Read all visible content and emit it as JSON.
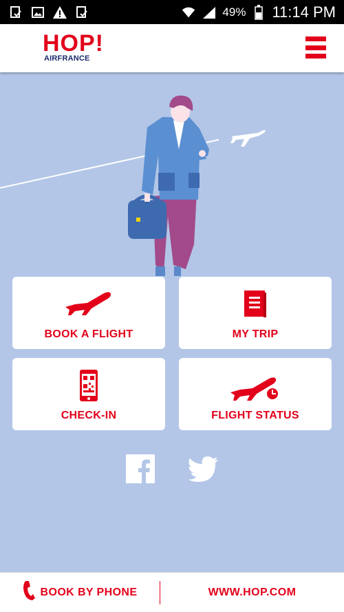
{
  "status_bar": {
    "battery": "49%",
    "time": "11:14 PM",
    "icons": [
      "download-check-icon",
      "image-icon",
      "warning-icon",
      "download-check-icon",
      "wifi-icon",
      "signal-icon",
      "battery-icon"
    ]
  },
  "header": {
    "logo_text": "HOP!",
    "logo_sub": "AIRFRANCE",
    "menu_icon": "hamburger-menu-icon"
  },
  "tiles": [
    {
      "label": "BOOK A FLIGHT",
      "icon": "airplane-takeoff-icon"
    },
    {
      "label": "MY TRIP",
      "icon": "document-icon"
    },
    {
      "label": "CHECK-IN",
      "icon": "mobile-qr-icon"
    },
    {
      "label": "FLIGHT STATUS",
      "icon": "airplane-clock-icon"
    }
  ],
  "social": [
    {
      "name": "facebook-icon"
    },
    {
      "name": "twitter-icon"
    }
  ],
  "bottom_bar": {
    "phone_label": "BOOK BY PHONE",
    "web_label": "WWW.HOP.COM"
  },
  "colors": {
    "brand_red": "#e2001a",
    "background": "#b3c6e7",
    "navy": "#1a2a6c"
  }
}
